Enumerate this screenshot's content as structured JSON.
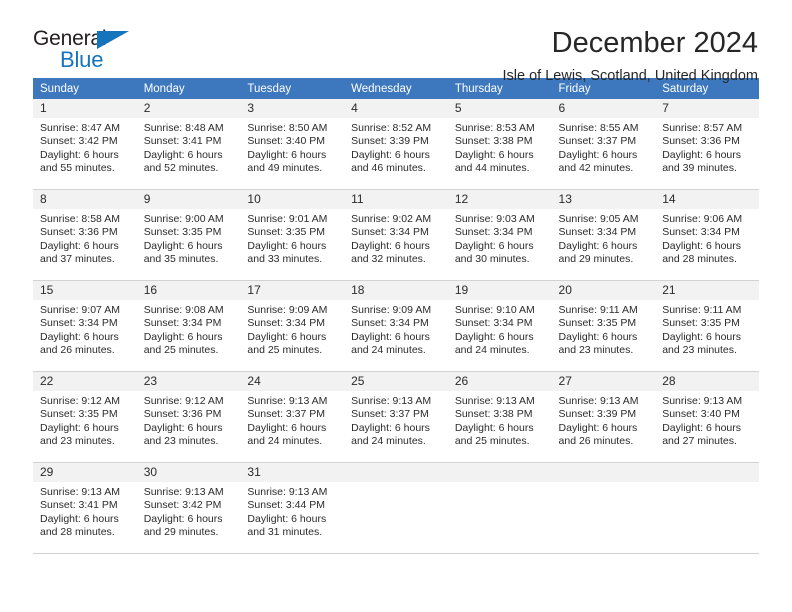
{
  "brand": {
    "name_top": "General",
    "name_bottom": "Blue",
    "triangle_icon": "triangle-icon",
    "accent_color": "#1574bb"
  },
  "header": {
    "title": "December 2024",
    "subtitle": "Isle of Lewis, Scotland, United Kingdom"
  },
  "calendar": {
    "header_bg": "#3d78bf",
    "daynum_bg": "#f2f2f2",
    "weekdays": [
      "Sunday",
      "Monday",
      "Tuesday",
      "Wednesday",
      "Thursday",
      "Friday",
      "Saturday"
    ],
    "weeks": [
      [
        {
          "day": "1",
          "sunrise": "Sunrise: 8:47 AM",
          "sunset": "Sunset: 3:42 PM",
          "daylight_line1": "Daylight: 6 hours",
          "daylight_line2": "and 55 minutes."
        },
        {
          "day": "2",
          "sunrise": "Sunrise: 8:48 AM",
          "sunset": "Sunset: 3:41 PM",
          "daylight_line1": "Daylight: 6 hours",
          "daylight_line2": "and 52 minutes."
        },
        {
          "day": "3",
          "sunrise": "Sunrise: 8:50 AM",
          "sunset": "Sunset: 3:40 PM",
          "daylight_line1": "Daylight: 6 hours",
          "daylight_line2": "and 49 minutes."
        },
        {
          "day": "4",
          "sunrise": "Sunrise: 8:52 AM",
          "sunset": "Sunset: 3:39 PM",
          "daylight_line1": "Daylight: 6 hours",
          "daylight_line2": "and 46 minutes."
        },
        {
          "day": "5",
          "sunrise": "Sunrise: 8:53 AM",
          "sunset": "Sunset: 3:38 PM",
          "daylight_line1": "Daylight: 6 hours",
          "daylight_line2": "and 44 minutes."
        },
        {
          "day": "6",
          "sunrise": "Sunrise: 8:55 AM",
          "sunset": "Sunset: 3:37 PM",
          "daylight_line1": "Daylight: 6 hours",
          "daylight_line2": "and 42 minutes."
        },
        {
          "day": "7",
          "sunrise": "Sunrise: 8:57 AM",
          "sunset": "Sunset: 3:36 PM",
          "daylight_line1": "Daylight: 6 hours",
          "daylight_line2": "and 39 minutes."
        }
      ],
      [
        {
          "day": "8",
          "sunrise": "Sunrise: 8:58 AM",
          "sunset": "Sunset: 3:36 PM",
          "daylight_line1": "Daylight: 6 hours",
          "daylight_line2": "and 37 minutes."
        },
        {
          "day": "9",
          "sunrise": "Sunrise: 9:00 AM",
          "sunset": "Sunset: 3:35 PM",
          "daylight_line1": "Daylight: 6 hours",
          "daylight_line2": "and 35 minutes."
        },
        {
          "day": "10",
          "sunrise": "Sunrise: 9:01 AM",
          "sunset": "Sunset: 3:35 PM",
          "daylight_line1": "Daylight: 6 hours",
          "daylight_line2": "and 33 minutes."
        },
        {
          "day": "11",
          "sunrise": "Sunrise: 9:02 AM",
          "sunset": "Sunset: 3:34 PM",
          "daylight_line1": "Daylight: 6 hours",
          "daylight_line2": "and 32 minutes."
        },
        {
          "day": "12",
          "sunrise": "Sunrise: 9:03 AM",
          "sunset": "Sunset: 3:34 PM",
          "daylight_line1": "Daylight: 6 hours",
          "daylight_line2": "and 30 minutes."
        },
        {
          "day": "13",
          "sunrise": "Sunrise: 9:05 AM",
          "sunset": "Sunset: 3:34 PM",
          "daylight_line1": "Daylight: 6 hours",
          "daylight_line2": "and 29 minutes."
        },
        {
          "day": "14",
          "sunrise": "Sunrise: 9:06 AM",
          "sunset": "Sunset: 3:34 PM",
          "daylight_line1": "Daylight: 6 hours",
          "daylight_line2": "and 28 minutes."
        }
      ],
      [
        {
          "day": "15",
          "sunrise": "Sunrise: 9:07 AM",
          "sunset": "Sunset: 3:34 PM",
          "daylight_line1": "Daylight: 6 hours",
          "daylight_line2": "and 26 minutes."
        },
        {
          "day": "16",
          "sunrise": "Sunrise: 9:08 AM",
          "sunset": "Sunset: 3:34 PM",
          "daylight_line1": "Daylight: 6 hours",
          "daylight_line2": "and 25 minutes."
        },
        {
          "day": "17",
          "sunrise": "Sunrise: 9:09 AM",
          "sunset": "Sunset: 3:34 PM",
          "daylight_line1": "Daylight: 6 hours",
          "daylight_line2": "and 25 minutes."
        },
        {
          "day": "18",
          "sunrise": "Sunrise: 9:09 AM",
          "sunset": "Sunset: 3:34 PM",
          "daylight_line1": "Daylight: 6 hours",
          "daylight_line2": "and 24 minutes."
        },
        {
          "day": "19",
          "sunrise": "Sunrise: 9:10 AM",
          "sunset": "Sunset: 3:34 PM",
          "daylight_line1": "Daylight: 6 hours",
          "daylight_line2": "and 24 minutes."
        },
        {
          "day": "20",
          "sunrise": "Sunrise: 9:11 AM",
          "sunset": "Sunset: 3:35 PM",
          "daylight_line1": "Daylight: 6 hours",
          "daylight_line2": "and 23 minutes."
        },
        {
          "day": "21",
          "sunrise": "Sunrise: 9:11 AM",
          "sunset": "Sunset: 3:35 PM",
          "daylight_line1": "Daylight: 6 hours",
          "daylight_line2": "and 23 minutes."
        }
      ],
      [
        {
          "day": "22",
          "sunrise": "Sunrise: 9:12 AM",
          "sunset": "Sunset: 3:35 PM",
          "daylight_line1": "Daylight: 6 hours",
          "daylight_line2": "and 23 minutes."
        },
        {
          "day": "23",
          "sunrise": "Sunrise: 9:12 AM",
          "sunset": "Sunset: 3:36 PM",
          "daylight_line1": "Daylight: 6 hours",
          "daylight_line2": "and 23 minutes."
        },
        {
          "day": "24",
          "sunrise": "Sunrise: 9:13 AM",
          "sunset": "Sunset: 3:37 PM",
          "daylight_line1": "Daylight: 6 hours",
          "daylight_line2": "and 24 minutes."
        },
        {
          "day": "25",
          "sunrise": "Sunrise: 9:13 AM",
          "sunset": "Sunset: 3:37 PM",
          "daylight_line1": "Daylight: 6 hours",
          "daylight_line2": "and 24 minutes."
        },
        {
          "day": "26",
          "sunrise": "Sunrise: 9:13 AM",
          "sunset": "Sunset: 3:38 PM",
          "daylight_line1": "Daylight: 6 hours",
          "daylight_line2": "and 25 minutes."
        },
        {
          "day": "27",
          "sunrise": "Sunrise: 9:13 AM",
          "sunset": "Sunset: 3:39 PM",
          "daylight_line1": "Daylight: 6 hours",
          "daylight_line2": "and 26 minutes."
        },
        {
          "day": "28",
          "sunrise": "Sunrise: 9:13 AM",
          "sunset": "Sunset: 3:40 PM",
          "daylight_line1": "Daylight: 6 hours",
          "daylight_line2": "and 27 minutes."
        }
      ],
      [
        {
          "day": "29",
          "sunrise": "Sunrise: 9:13 AM",
          "sunset": "Sunset: 3:41 PM",
          "daylight_line1": "Daylight: 6 hours",
          "daylight_line2": "and 28 minutes."
        },
        {
          "day": "30",
          "sunrise": "Sunrise: 9:13 AM",
          "sunset": "Sunset: 3:42 PM",
          "daylight_line1": "Daylight: 6 hours",
          "daylight_line2": "and 29 minutes."
        },
        {
          "day": "31",
          "sunrise": "Sunrise: 9:13 AM",
          "sunset": "Sunset: 3:44 PM",
          "daylight_line1": "Daylight: 6 hours",
          "daylight_line2": "and 31 minutes."
        },
        {
          "day": "",
          "sunrise": "",
          "sunset": "",
          "daylight_line1": "",
          "daylight_line2": ""
        },
        {
          "day": "",
          "sunrise": "",
          "sunset": "",
          "daylight_line1": "",
          "daylight_line2": ""
        },
        {
          "day": "",
          "sunrise": "",
          "sunset": "",
          "daylight_line1": "",
          "daylight_line2": ""
        },
        {
          "day": "",
          "sunrise": "",
          "sunset": "",
          "daylight_line1": "",
          "daylight_line2": ""
        }
      ]
    ]
  }
}
